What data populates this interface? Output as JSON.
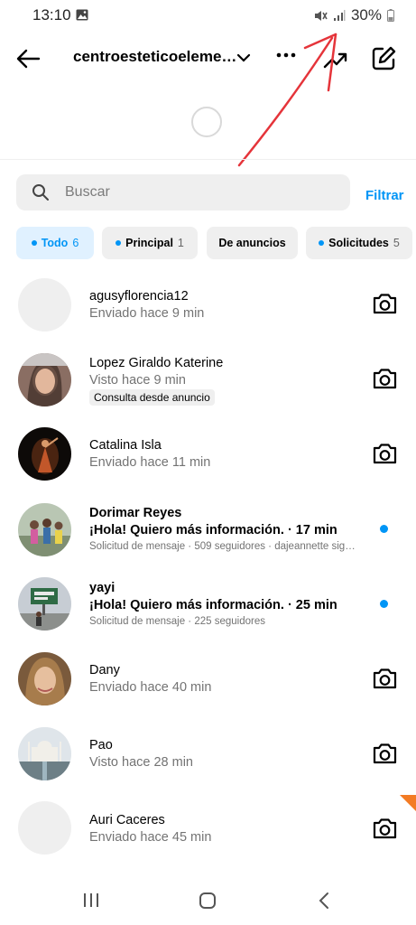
{
  "status_bar": {
    "time": "13:10",
    "battery": "30%"
  },
  "header": {
    "account_name": "centroesteticoeleme…"
  },
  "search": {
    "placeholder": "Buscar",
    "filter_label": "Filtrar"
  },
  "tabs": [
    {
      "label": "Todo",
      "count": "6",
      "active": true,
      "dot": true
    },
    {
      "label": "Principal",
      "count": "1",
      "active": false,
      "dot": true
    },
    {
      "label": "De anuncios",
      "count": "",
      "active": false,
      "dot": false
    },
    {
      "label": "Solicitudes",
      "count": "5",
      "active": false,
      "dot": true
    }
  ],
  "conversations": [
    {
      "name": "agusyflorencia12",
      "status": "Enviado hace 9 min",
      "avatar": "placeholder",
      "action_icon": "camera-icon"
    },
    {
      "name": "Lopez Giraldo Katerine",
      "status": "Visto hace 9 min",
      "tag": "Consulta desde anuncio",
      "avatar": "photo-woman-selfie",
      "action_icon": "camera-icon"
    },
    {
      "name": "Catalina Isla",
      "status": "Enviado hace 11 min",
      "avatar": "photo-dancer",
      "action_icon": "camera-icon"
    },
    {
      "name": "Dorimar Reyes",
      "message": "¡Hola! Quiero más información. · 17 min",
      "meta": "Solicitud de mensaje · 509 seguidores · dajeannette sig…",
      "unread": true,
      "avatar": "photo-group"
    },
    {
      "name": "yayi",
      "message": "¡Hola! Quiero más información. · 25 min",
      "meta": "Solicitud de mensaje · 225 seguidores",
      "unread": true,
      "avatar": "photo-sign"
    },
    {
      "name": "Dany",
      "status": "Enviado hace 40 min",
      "avatar": "photo-woman",
      "action_icon": "camera-icon"
    },
    {
      "name": "Pao",
      "status": "Visto hace 28 min",
      "avatar": "photo-taj-mahal",
      "action_icon": "camera-icon"
    },
    {
      "name": "Auri Caceres",
      "status": "Enviado hace 45 min",
      "avatar": "placeholder",
      "action_icon": "camera-icon"
    }
  ],
  "colors": {
    "accent": "#0095f6",
    "annotation_arrow": "#e5343a",
    "chip_bg": "#efefef"
  }
}
